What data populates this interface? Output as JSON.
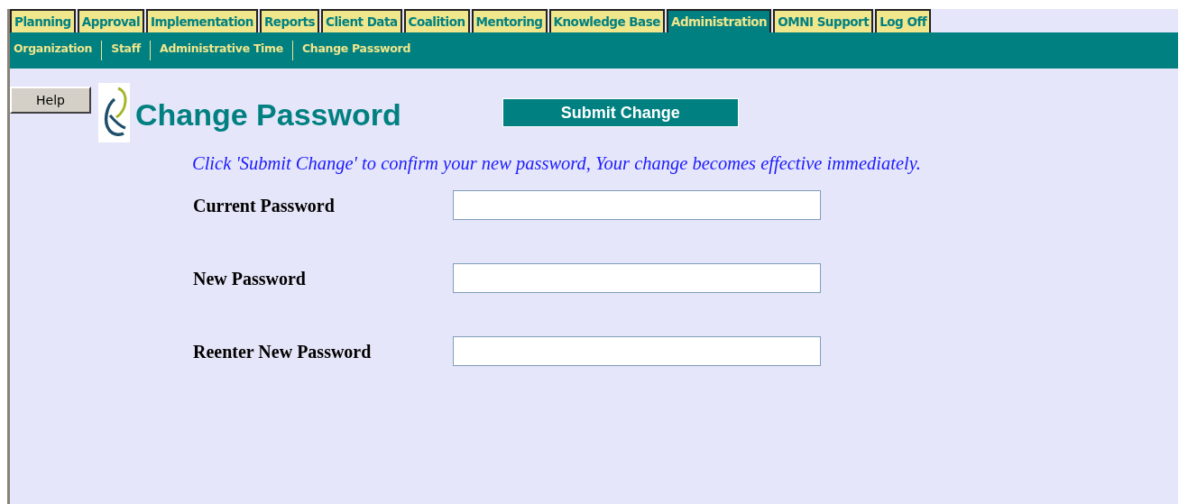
{
  "tabs": [
    {
      "label": "Planning",
      "selected": false
    },
    {
      "label": "Approval",
      "selected": false
    },
    {
      "label": "Implementation",
      "selected": false
    },
    {
      "label": "Reports",
      "selected": false
    },
    {
      "label": "Client Data",
      "selected": false
    },
    {
      "label": "Coalition",
      "selected": false
    },
    {
      "label": "Mentoring",
      "selected": false
    },
    {
      "label": "Knowledge Base",
      "selected": false
    },
    {
      "label": "Administration",
      "selected": true
    },
    {
      "label": "OMNI Support",
      "selected": false
    },
    {
      "label": "Log Off",
      "selected": false
    }
  ],
  "subnav": [
    "Organization",
    "Staff",
    "Administrative Time",
    "Change Password"
  ],
  "help_button": "Help",
  "title": "Change Password",
  "submit_button": "Submit Change",
  "instruction": "Click 'Submit Change' to confirm your new password, Your change becomes effective immediately.",
  "fields": [
    {
      "label": "Current Password"
    },
    {
      "label": "New Password"
    },
    {
      "label": "Reenter New Password"
    }
  ]
}
